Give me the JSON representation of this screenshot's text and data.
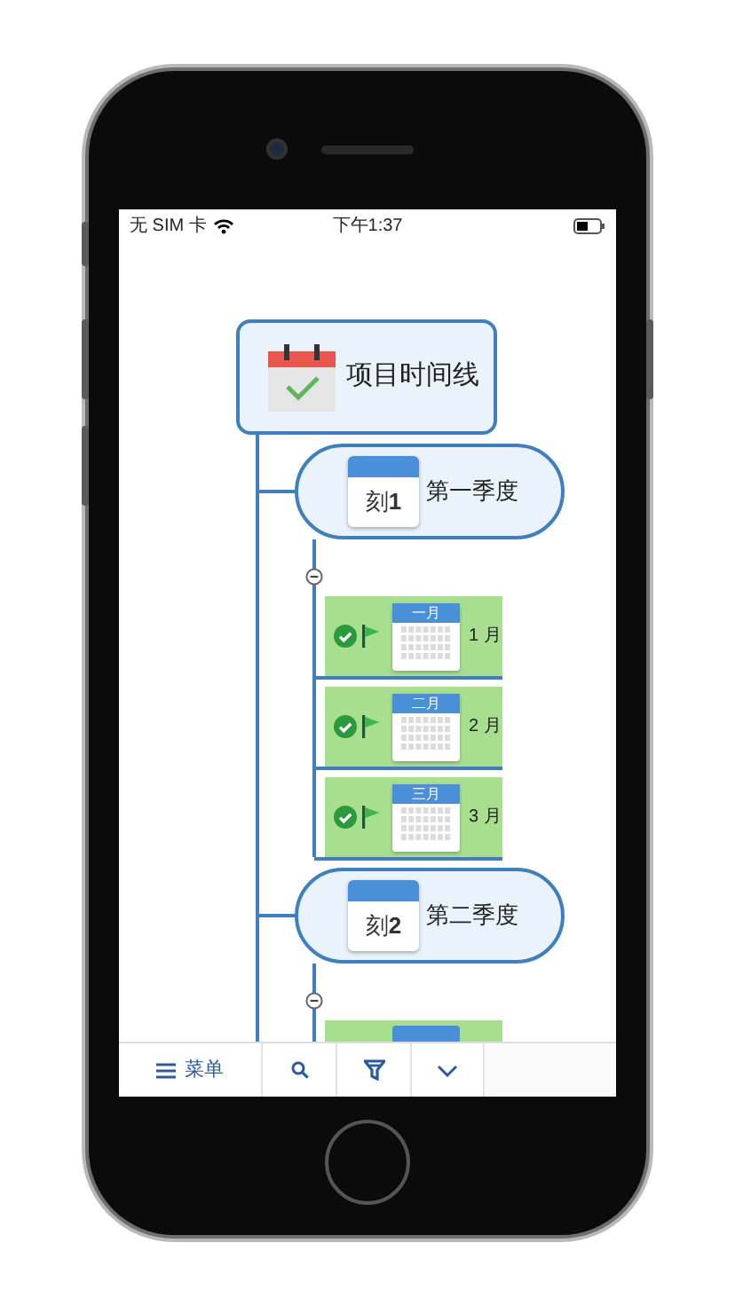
{
  "status_bar": {
    "carrier": "无 SIM 卡",
    "time": "下午1:37"
  },
  "root": {
    "title": "项目时间线"
  },
  "quarters": [
    {
      "badge": "刻**1**",
      "title": "第一季度",
      "expanded": true,
      "more_below": false,
      "months": [
        {
          "header": "一月",
          "label": "1 月",
          "done": true,
          "flagged": true
        },
        {
          "header": "二月",
          "label": "2 月",
          "done": true,
          "flagged": true
        },
        {
          "header": "三月",
          "label": "3 月",
          "done": true,
          "flagged": true
        }
      ]
    },
    {
      "badge": "刻**2**",
      "title": "第二季度",
      "expanded": true,
      "more_below": true
    }
  ],
  "toolbar": {
    "menu_label": "菜单"
  }
}
